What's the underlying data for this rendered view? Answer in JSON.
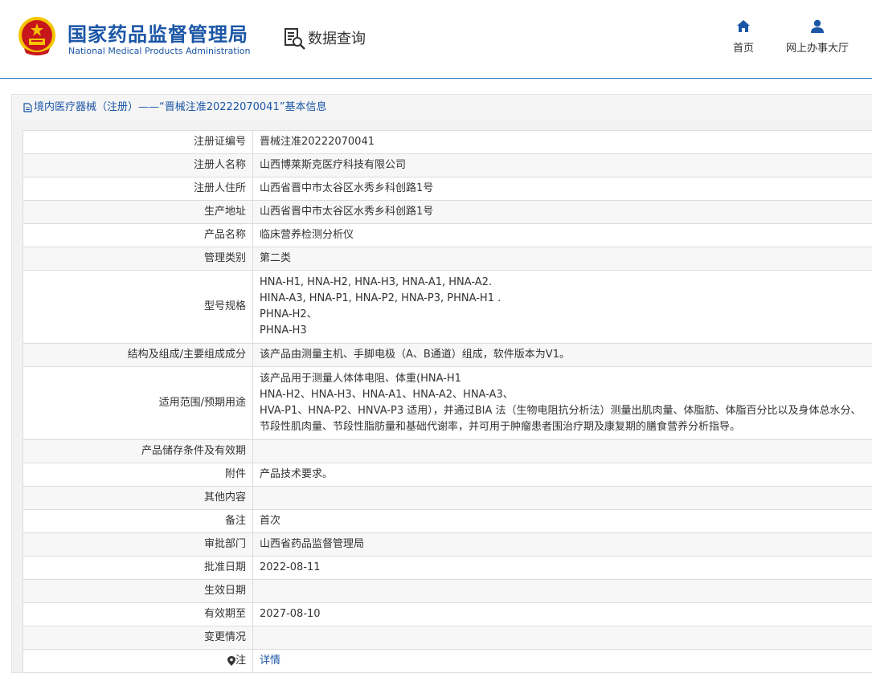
{
  "header": {
    "org_name_cn": "国家药品监督管理局",
    "org_name_en": "National Medical Products Administration",
    "query_label": "数据查询",
    "nav": [
      {
        "label": "首页",
        "icon": "home-icon"
      },
      {
        "label": "网上办事大厅",
        "icon": "user-icon"
      }
    ]
  },
  "breadcrumb": "境内医疗器械（注册）——“晋械注准20222070041”基本信息",
  "colors": {
    "brand_blue": "#1b56a6",
    "emblem_red": "#c8161d",
    "emblem_gold": "#f5c400"
  },
  "rows": [
    {
      "label": "注册证编号",
      "value": "晋械注准20222070041"
    },
    {
      "label": "注册人名称",
      "value": "山西博莱斯克医疗科技有限公司"
    },
    {
      "label": "注册人住所",
      "value": "山西省晋中市太谷区水秀乡科创路1号"
    },
    {
      "label": "生产地址",
      "value": "山西省晋中市太谷区水秀乡科创路1号"
    },
    {
      "label": "产品名称",
      "value": "临床营养检测分析仪"
    },
    {
      "label": "管理类别",
      "value": "第二类"
    },
    {
      "label": "型号规格",
      "lines": [
        "HNA-H1, HNA-H2, HNA-H3, HNA-A1, HNA-A2.",
        "HINA-A3, HNA-P1, HNA-P2, HNA-P3, PHNA-H1 .",
        "PHNA-H2、",
        "PHNA-H3"
      ]
    },
    {
      "label": "结构及组成/主要组成成分",
      "value": "该产品由测量主机、手脚电极（A、B通道）组成，软件版本为V1。"
    },
    {
      "label": "适用范围/预期用途",
      "lines": [
        "该产品用于测量人体体电阻、体重(HNA-H1",
        "HNA-H2、HNA-H3、HNA-A1、HNA-A2、HNA-A3、",
        "HVA-P1、HNA-P2、HNVA-P3 适用），并通过BIA 法（生物电阻抗分析法）测量出肌肉量、体脂肪、体脂百分比以及身体总水分、节段性肌肉量、节段性脂肪量和基础代谢率，并可用于肿瘤患者围治疗期及康复期的膳食营养分析指导。"
      ]
    },
    {
      "label": "产品储存条件及有效期",
      "value": ""
    },
    {
      "label": "附件",
      "value": "产品技术要求。"
    },
    {
      "label": "其他内容",
      "value": ""
    },
    {
      "label": "备注",
      "value": "首次"
    },
    {
      "label": "审批部门",
      "value": "山西省药品监督管理局"
    },
    {
      "label": "批准日期",
      "value": "2022-08-11"
    },
    {
      "label": "生效日期",
      "value": ""
    },
    {
      "label": "有效期至",
      "value": "2027-08-10"
    },
    {
      "label": "变更情况",
      "value": ""
    },
    {
      "label": "注",
      "value": "详情",
      "icon": "location-pin-icon"
    }
  ]
}
